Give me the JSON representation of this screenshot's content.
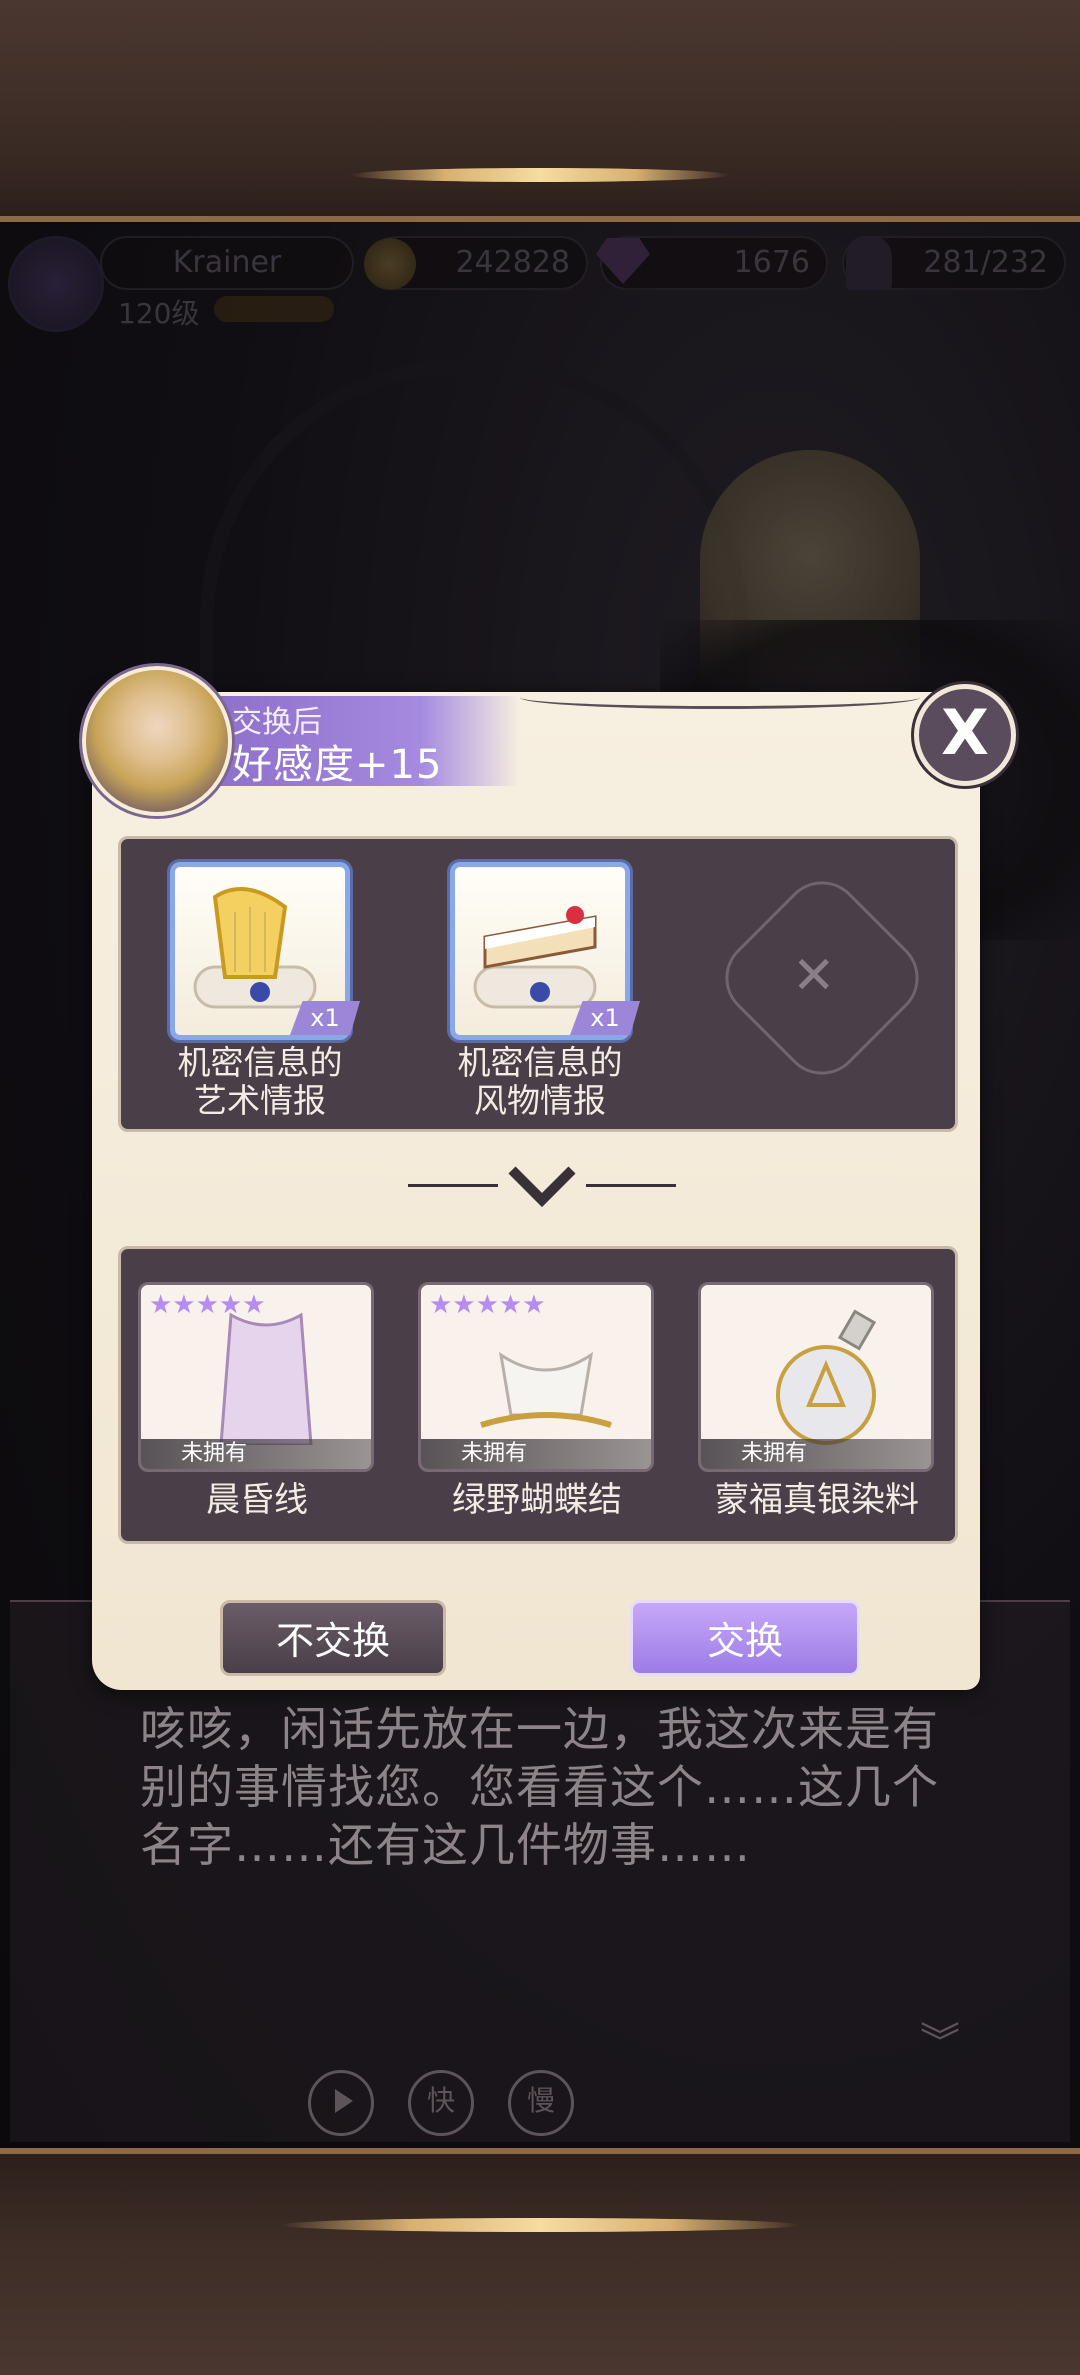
{
  "hud": {
    "player_name": "Krainer",
    "level": "120级",
    "gold": "242828",
    "diamonds": "1676",
    "stamina": "281/232"
  },
  "popup": {
    "banner_label": "交换后",
    "banner_value": "好感度+15",
    "close_label": "X",
    "give_items": [
      {
        "name": "机密信息的\n艺术情报",
        "qty": "x1",
        "icon": "harp-scroll-icon"
      },
      {
        "name": "机密信息的\n风物情报",
        "qty": "x1",
        "icon": "cake-scroll-icon"
      }
    ],
    "receive_items": [
      {
        "name": "晨昏线",
        "status": "未拥有",
        "stars": "★★★★★",
        "icon": "lace-dress-icon"
      },
      {
        "name": "绿野蝴蝶结",
        "status": "未拥有",
        "stars": "★★★★★",
        "icon": "bow-top-icon"
      },
      {
        "name": "蒙福真银染料",
        "status": "未拥有",
        "stars": "",
        "icon": "dye-flask-icon"
      }
    ],
    "decline_label": "不交换",
    "accept_label": "交换"
  },
  "story": {
    "text": "咳咳，闲话先放在一边，我这次来是有别的事情找您。您看看这个……这几个名字……还有这几件物事……"
  },
  "controls": {
    "play_icon": "play-icon",
    "fast_label": "快",
    "slow_label": "慢"
  }
}
